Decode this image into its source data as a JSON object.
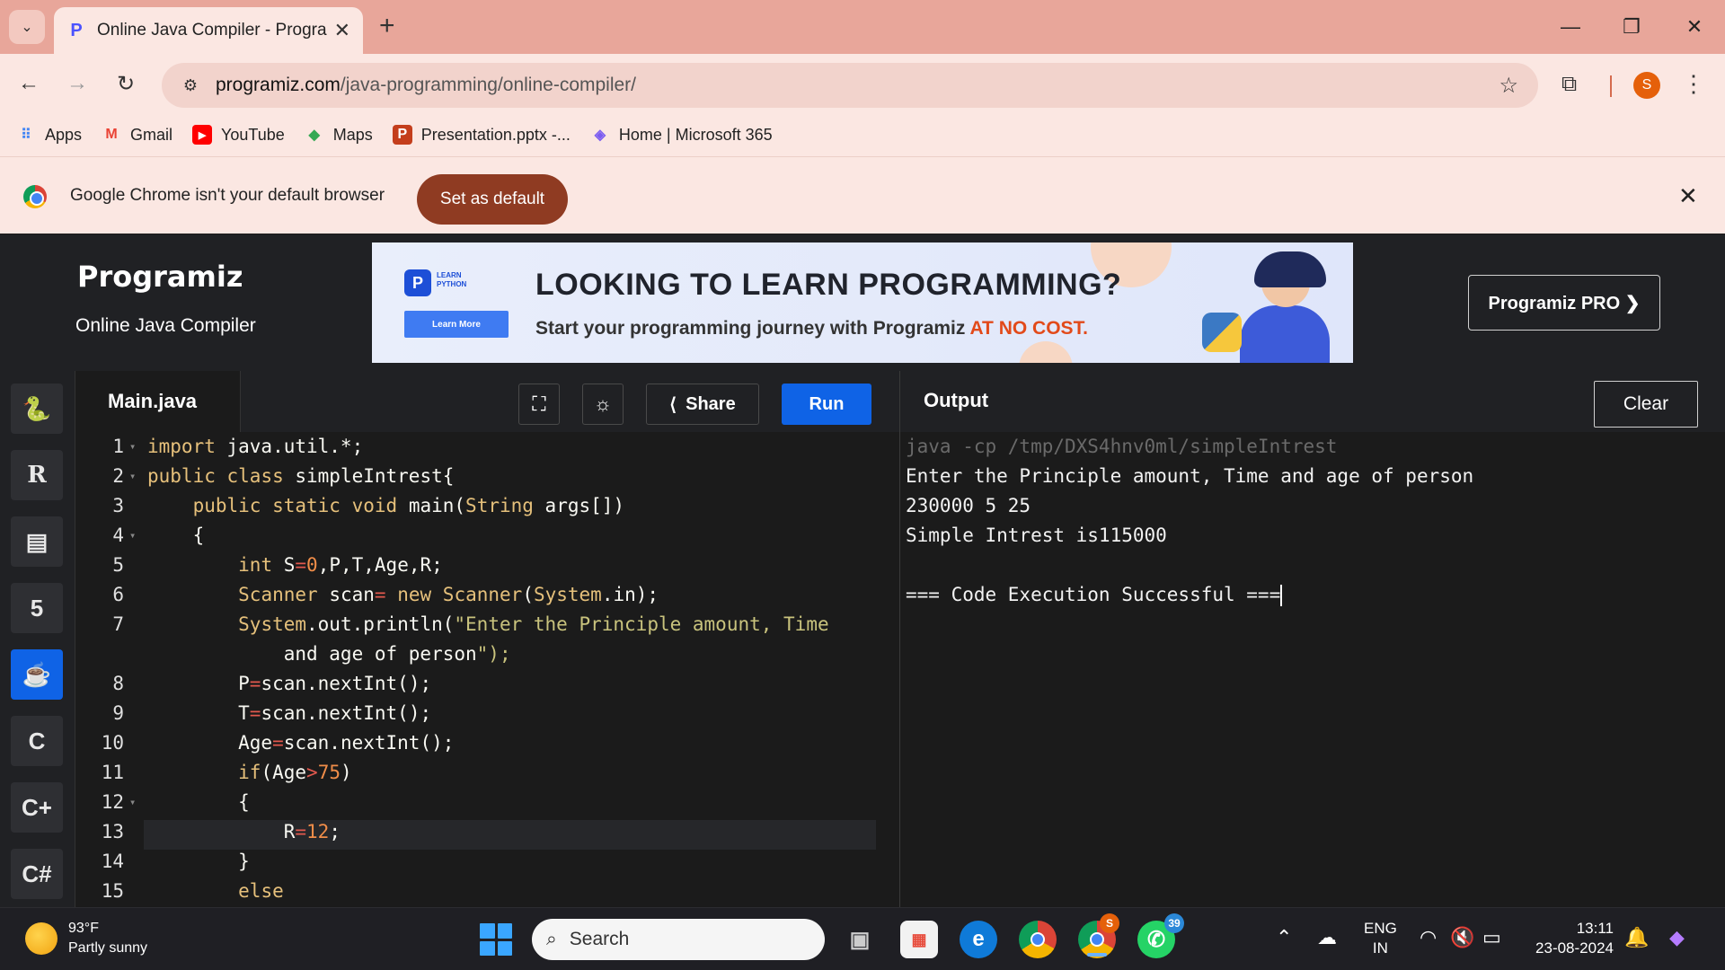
{
  "browser": {
    "tab_title": "Online Java Compiler - Program",
    "url_host": "programiz.com",
    "url_path": "/java-programming/online-compiler/",
    "bookmarks": [
      {
        "label": "Apps",
        "icon": "apps-grid-icon"
      },
      {
        "label": "Gmail",
        "icon": "gmail-icon"
      },
      {
        "label": "YouTube",
        "icon": "youtube-icon"
      },
      {
        "label": "Maps",
        "icon": "maps-icon"
      },
      {
        "label": "Presentation.pptx -...",
        "icon": "powerpoint-icon"
      },
      {
        "label": "Home | Microsoft 365",
        "icon": "microsoft365-icon"
      }
    ],
    "avatar_letter": "S",
    "infobar_text": "Google Chrome isn't your default browser",
    "set_default_label": "Set as default"
  },
  "site": {
    "logo": "Programiz",
    "subtitle": "Online Java Compiler",
    "pro_button": "Programiz PRO ❯",
    "banner": {
      "badge_line1": "LEARN",
      "badge_line2": "PYTHON",
      "learn_more": "Learn More",
      "title": "LOOKING TO LEARN PROGRAMMING?",
      "subtitle": "Start your programming journey with Programiz ",
      "highlight": "AT NO COST."
    }
  },
  "languages": [
    "python-icon",
    "r-icon",
    "sql-icon",
    "html5-icon",
    "java-icon",
    "c-icon",
    "cpp-icon",
    "csharp-icon"
  ],
  "editor": {
    "file_name": "Main.java",
    "share_label": "Share",
    "run_label": "Run"
  },
  "code_lines": [
    {
      "n": "1",
      "fold": true,
      "text": "import java.util.*;"
    },
    {
      "n": "2",
      "fold": true,
      "text": "public class simpleIntrest{"
    },
    {
      "n": "3",
      "fold": false,
      "text": "    public static void main(String args[])"
    },
    {
      "n": "4",
      "fold": true,
      "text": "    {"
    },
    {
      "n": "5",
      "fold": false,
      "text": "        int S=0,P,T,Age,R;"
    },
    {
      "n": "6",
      "fold": false,
      "text": "        Scanner scan= new Scanner(System.in);"
    },
    {
      "n": "7",
      "fold": false,
      "text": "        System.out.println(\"Enter the Principle amount, Time"
    },
    {
      "n": "",
      "fold": false,
      "text": "            and age of person\");"
    },
    {
      "n": "8",
      "fold": false,
      "text": "        P=scan.nextInt();"
    },
    {
      "n": "9",
      "fold": false,
      "text": "        T=scan.nextInt();"
    },
    {
      "n": "10",
      "fold": false,
      "text": "        Age=scan.nextInt();"
    },
    {
      "n": "11",
      "fold": false,
      "text": "        if(Age>75)"
    },
    {
      "n": "12",
      "fold": true,
      "text": "        {"
    },
    {
      "n": "13",
      "fold": false,
      "text": "            R=12;"
    },
    {
      "n": "14",
      "fold": false,
      "text": "        }"
    },
    {
      "n": "15",
      "fold": false,
      "text": "        else"
    }
  ],
  "output": {
    "title": "Output",
    "clear_label": "Clear",
    "lines": [
      "java -cp /tmp/DXS4hnv0ml/simpleIntrest",
      "Enter the Principle amount, Time and age of person",
      "230000 5 25",
      "Simple Intrest is115000",
      "",
      "=== Code Execution Successful ==="
    ]
  },
  "taskbar": {
    "temperature": "93°F",
    "weather": "Partly sunny",
    "search_placeholder": "Search",
    "whatsapp_badge": "39",
    "chrome_badge": "S",
    "lang_line1": "ENG",
    "lang_line2": "IN",
    "time": "13:11",
    "date": "23-08-2024"
  }
}
